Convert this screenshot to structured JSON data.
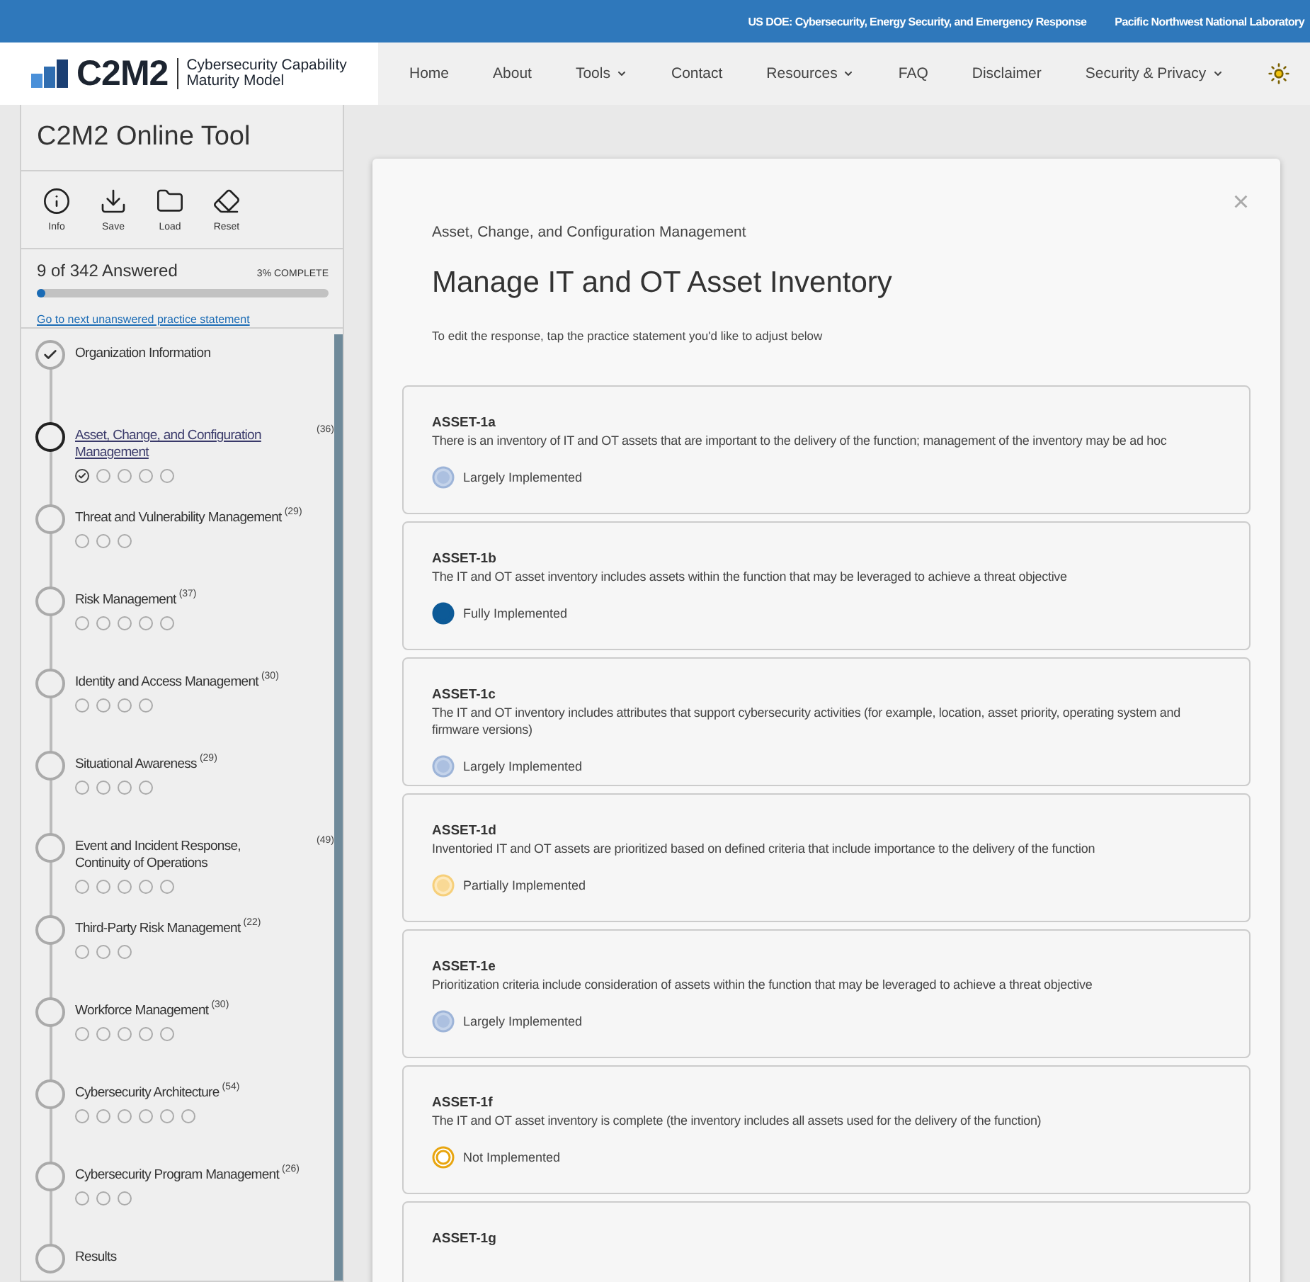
{
  "top_bar": {
    "links": [
      "US DOE: Cybersecurity, Energy Security, and Emergency Response",
      "Pacific Northwest National Laboratory"
    ]
  },
  "logo": {
    "mark": "C2M2",
    "tagline": [
      "Cybersecurity Capability",
      "Maturity Model"
    ]
  },
  "nav": [
    {
      "label": "Home",
      "has_menu": false
    },
    {
      "label": "About",
      "has_menu": false
    },
    {
      "label": "Tools",
      "has_menu": true
    },
    {
      "label": "Contact",
      "has_menu": false
    },
    {
      "label": "Resources",
      "has_menu": true
    },
    {
      "label": "FAQ",
      "has_menu": false
    },
    {
      "label": "Disclaimer",
      "has_menu": false
    },
    {
      "label": "Security & Privacy",
      "has_menu": true
    }
  ],
  "sidebar": {
    "title": "C2M2 Online Tool",
    "tools": [
      {
        "kind": "info",
        "label": "Info"
      },
      {
        "kind": "save",
        "label": "Save"
      },
      {
        "kind": "load",
        "label": "Load"
      },
      {
        "kind": "reset",
        "label": "Reset"
      }
    ],
    "progress": {
      "answered": "9 of 342 Answered",
      "percent": "3% COMPLETE",
      "level": 0.03,
      "link": "Go to next unanswered practice statement"
    },
    "steps": [
      {
        "label": "Organization Information",
        "done": true,
        "current": false
      },
      {
        "label": "Asset, Change, and Configuration Management",
        "count": "(36)",
        "done": false,
        "current": true,
        "practices": [
          {
            "answered": true
          },
          {
            "answered": false
          },
          {
            "answered": false
          },
          {
            "answered": false
          },
          {
            "answered": false
          }
        ]
      },
      {
        "label": "Threat and Vulnerability Management",
        "count": "(29)",
        "done": false,
        "current": false,
        "practices": [
          {
            "answered": false
          },
          {
            "answered": false
          },
          {
            "answered": false
          }
        ]
      },
      {
        "label": "Risk Management",
        "count": "(37)",
        "done": false,
        "current": false,
        "practices": [
          {
            "answered": false
          },
          {
            "answered": false
          },
          {
            "answered": false
          },
          {
            "answered": false
          },
          {
            "answered": false
          }
        ]
      },
      {
        "label": "Identity and Access Management",
        "count": "(30)",
        "done": false,
        "current": false,
        "practices": [
          {
            "answered": false
          },
          {
            "answered": false
          },
          {
            "answered": false
          },
          {
            "answered": false
          }
        ]
      },
      {
        "label": "Situational Awareness",
        "count": "(29)",
        "done": false,
        "current": false,
        "practices": [
          {
            "answered": false
          },
          {
            "answered": false
          },
          {
            "answered": false
          },
          {
            "answered": false
          }
        ]
      },
      {
        "label": "Event and Incident Response, Continuity of Operations",
        "count": "(49)",
        "done": false,
        "current": false,
        "practices": [
          {
            "answered": false
          },
          {
            "answered": false
          },
          {
            "answered": false
          },
          {
            "answered": false
          },
          {
            "answered": false
          }
        ]
      },
      {
        "label": "Third-Party Risk Management",
        "count": "(22)",
        "done": false,
        "current": false,
        "practices": [
          {
            "answered": false
          },
          {
            "answered": false
          },
          {
            "answered": false
          }
        ]
      },
      {
        "label": "Workforce Management",
        "count": "(30)",
        "done": false,
        "current": false,
        "practices": [
          {
            "answered": false
          },
          {
            "answered": false
          },
          {
            "answered": false
          },
          {
            "answered": false
          },
          {
            "answered": false
          }
        ]
      },
      {
        "label": "Cybersecurity Architecture",
        "count": "(54)",
        "done": false,
        "current": false,
        "practices": [
          {
            "answered": false
          },
          {
            "answered": false
          },
          {
            "answered": false
          },
          {
            "answered": false
          },
          {
            "answered": false
          },
          {
            "answered": false
          }
        ]
      },
      {
        "label": "Cybersecurity Program Management",
        "count": "(26)",
        "done": false,
        "current": false,
        "practices": [
          {
            "answered": false
          },
          {
            "answered": false
          },
          {
            "answered": false
          }
        ]
      },
      {
        "label": "Results",
        "done": false,
        "current": false
      }
    ]
  },
  "panel": {
    "close": "×",
    "domain": "Asset, Change, and Configuration Management",
    "title": "Manage IT and OT Asset Inventory",
    "instruction": "To edit the response, tap the practice statement you'd like to adjust below",
    "practices": [
      {
        "id": "ASSET-1a",
        "text": "There is an inventory of IT and OT assets that are important to the delivery of the function; management of the inventory may be ad hoc",
        "kind": "largely",
        "response": "Largely Implemented"
      },
      {
        "id": "ASSET-1b",
        "text": "The IT and OT asset inventory includes assets within the function that may be leveraged to achieve a threat objective",
        "kind": "fully",
        "response": "Fully Implemented"
      },
      {
        "id": "ASSET-1c",
        "text": "The IT and OT inventory includes attributes that support cybersecurity activities (for example, location, asset priority, operating system and firmware versions)",
        "kind": "largely",
        "response": "Largely Implemented"
      },
      {
        "id": "ASSET-1d",
        "text": "Inventoried IT and OT assets are prioritized based on defined criteria that include importance to the delivery of the function",
        "kind": "partially",
        "response": "Partially Implemented"
      },
      {
        "id": "ASSET-1e",
        "text": "Prioritization criteria include consideration of assets within the function that may be leveraged to achieve a threat objective",
        "kind": "largely",
        "response": "Largely Implemented"
      },
      {
        "id": "ASSET-1f",
        "text": "The IT and OT asset inventory is complete (the inventory includes all assets used for the delivery of the function)",
        "kind": "not",
        "response": "Not Implemented"
      },
      {
        "id": "ASSET-1g"
      }
    ]
  }
}
